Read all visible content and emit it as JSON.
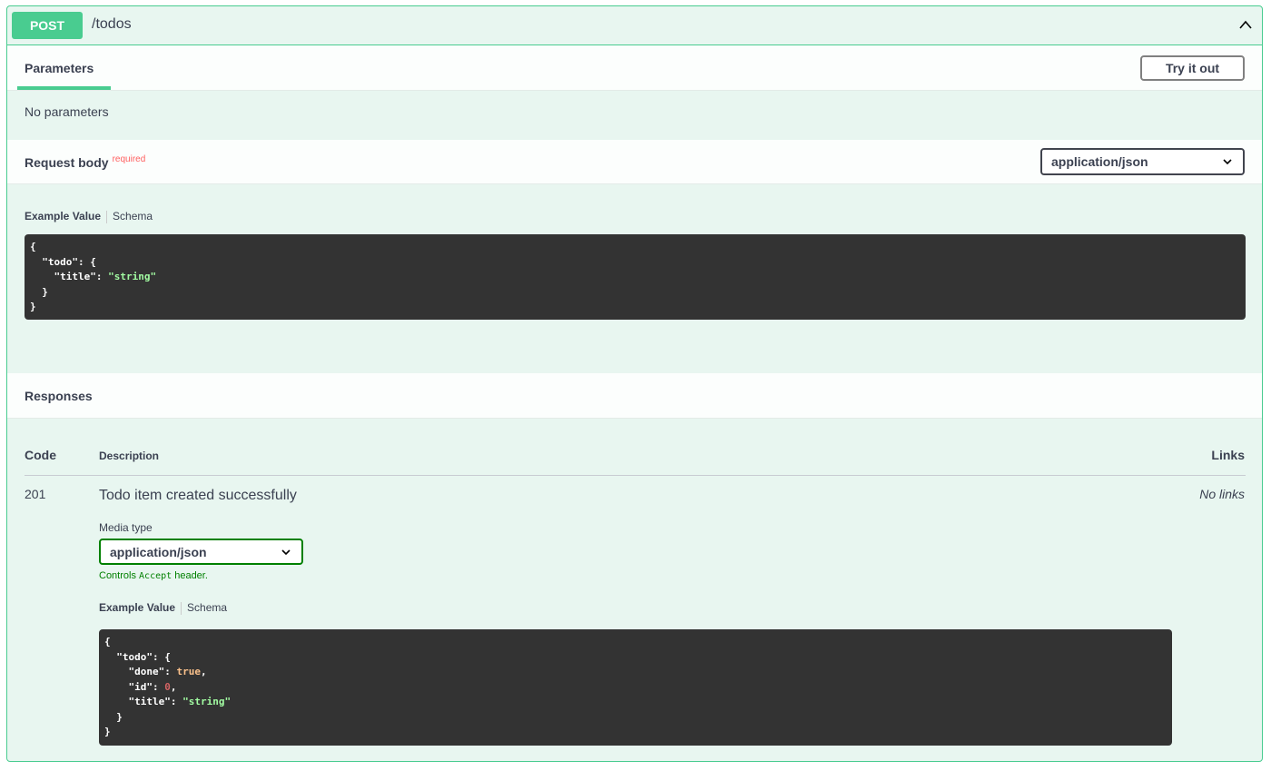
{
  "operation": {
    "method": "POST",
    "path": "/todos"
  },
  "parameters": {
    "tab_label": "Parameters",
    "try_button": "Try it out",
    "empty_text": "No parameters"
  },
  "request_body": {
    "title": "Request body",
    "required_label": "required",
    "content_type": "application/json",
    "example_tab": "Example Value",
    "schema_tab": "Schema",
    "example_lines": {
      "l1": "{",
      "l2_key": "  \"todo\"",
      "l2_rest": ": {",
      "l3_key": "    \"title\"",
      "l3_sep": ": ",
      "l3_val": "\"string\"",
      "l4": "  }",
      "l5": "}"
    }
  },
  "responses": {
    "title": "Responses",
    "columns": {
      "code": "Code",
      "description": "Description",
      "links": "Links"
    },
    "items": [
      {
        "code": "201",
        "description": "Todo item created successfully",
        "links": "No links",
        "media_type_label": "Media type",
        "media_type": "application/json",
        "controls_prefix": "Controls ",
        "controls_code": "Accept",
        "controls_suffix": " header.",
        "example_tab": "Example Value",
        "schema_tab": "Schema",
        "example_lines": {
          "l1": "{",
          "l2_key": "  \"todo\"",
          "l2_rest": ": {",
          "l3_key": "    \"done\"",
          "l3_sep": ": ",
          "l3_val": "true",
          "l3_end": ",",
          "l4_key": "    \"id\"",
          "l4_sep": ": ",
          "l4_val": "0",
          "l4_end": ",",
          "l5_key": "    \"title\"",
          "l5_sep": ": ",
          "l5_val": "\"string\"",
          "l6": "  }",
          "l7": "}"
        }
      }
    ]
  },
  "colors": {
    "post_accent": "#49cc90",
    "block_background": "#e8f6f0",
    "required": "#ff6060",
    "code_background": "#333333"
  }
}
